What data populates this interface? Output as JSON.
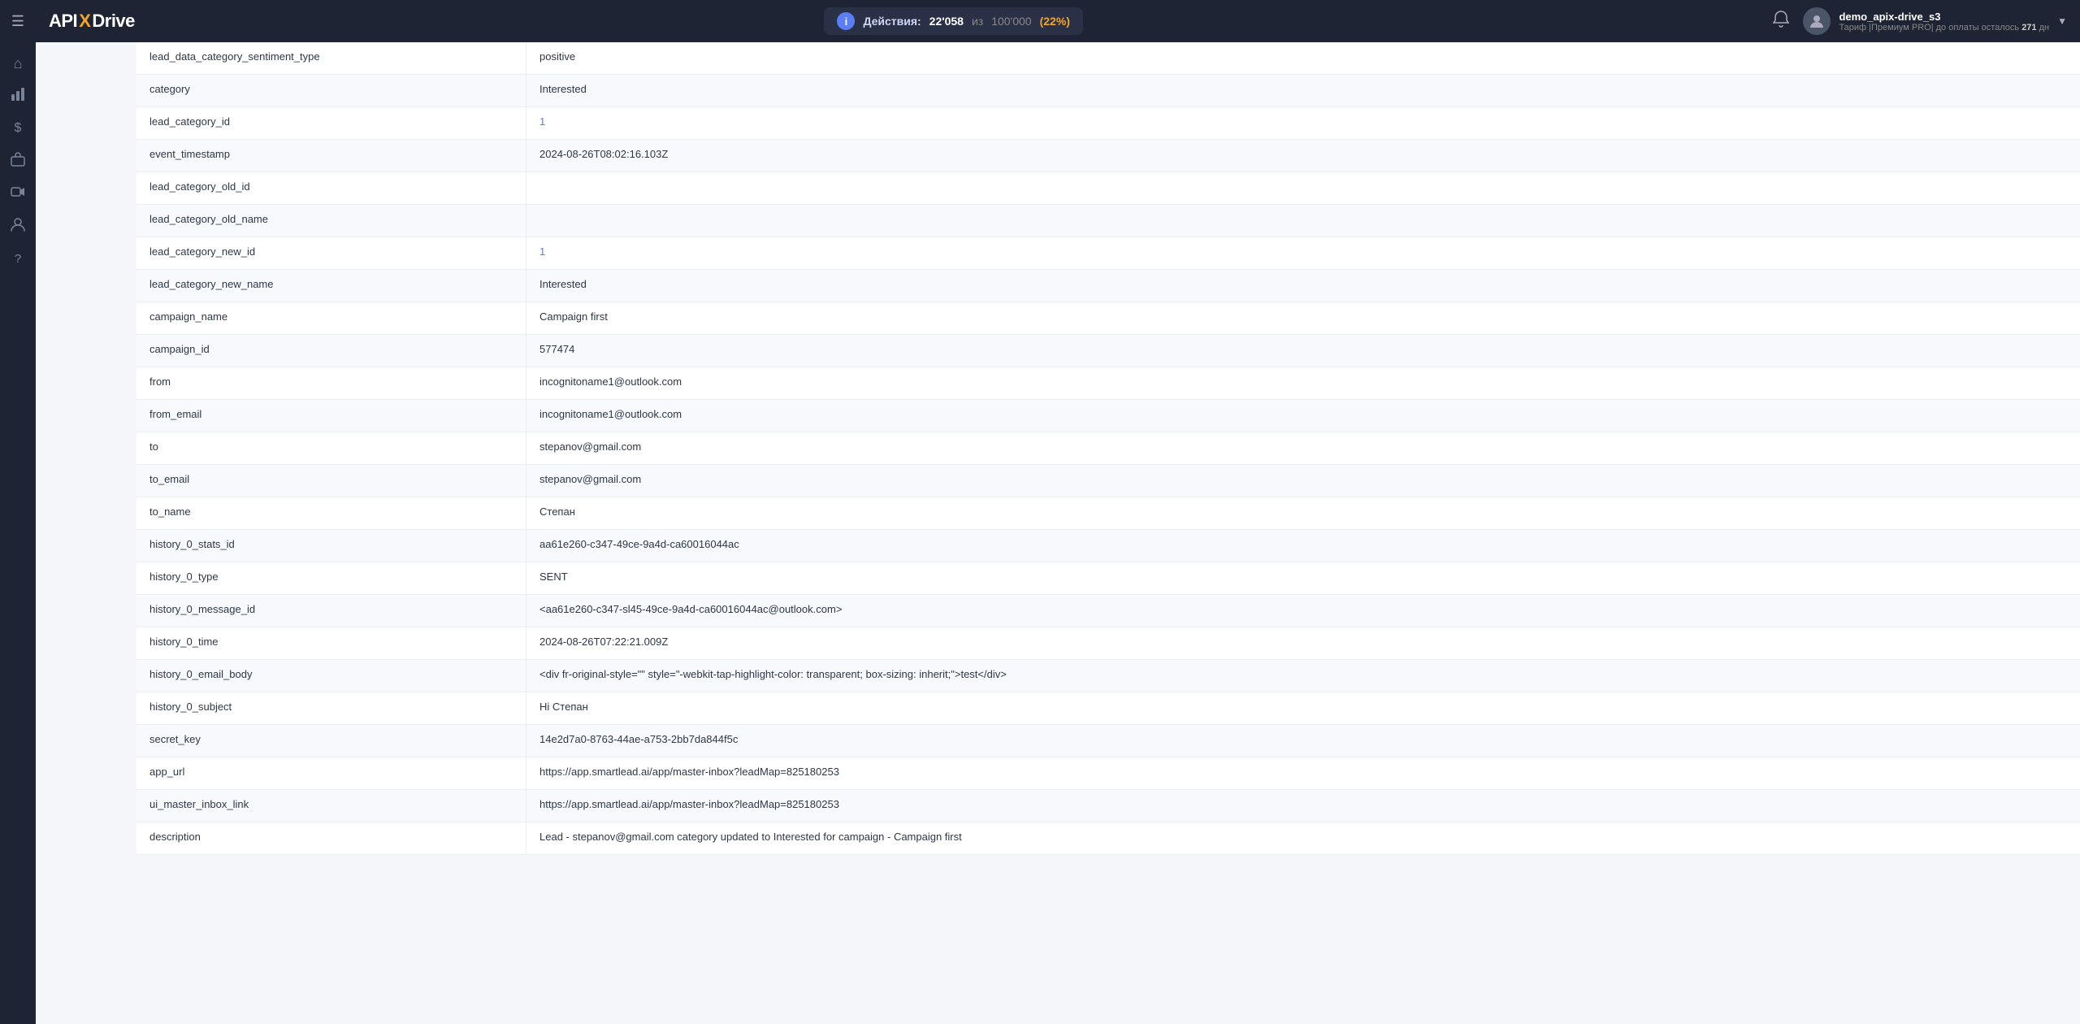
{
  "sidebar": {
    "hamburger": "☰",
    "items": [
      {
        "name": "home",
        "icon": "⌂"
      },
      {
        "name": "diagram",
        "icon": "⊞"
      },
      {
        "name": "dollar",
        "icon": "$"
      },
      {
        "name": "briefcase",
        "icon": "⊡"
      },
      {
        "name": "video",
        "icon": "▶"
      },
      {
        "name": "user",
        "icon": "👤"
      },
      {
        "name": "help",
        "icon": "?"
      }
    ]
  },
  "topbar": {
    "logo": {
      "api": "API",
      "x": "X",
      "drive": "Drive"
    },
    "actions_label": "Действия:",
    "actions_count": "22'058",
    "actions_separator": "из",
    "actions_limit": "100'000",
    "actions_pct": "(22%)",
    "user": {
      "name": "demo_apix-drive_s3",
      "plan_label": "Тариф |Премиум PRO| до оплаты осталось",
      "days": "271",
      "days_label": "дн"
    }
  },
  "table": {
    "rows": [
      {
        "field": "lead_data_category_sentiment_type",
        "value": "positive",
        "type": "normal"
      },
      {
        "field": "category",
        "value": "Interested",
        "type": "normal"
      },
      {
        "field": "lead_category_id",
        "value": "1",
        "type": "blue"
      },
      {
        "field": "event_timestamp",
        "value": "2024-08-26T08:02:16.103Z",
        "type": "normal"
      },
      {
        "field": "lead_category_old_id",
        "value": "",
        "type": "normal"
      },
      {
        "field": "lead_category_old_name",
        "value": "",
        "type": "normal"
      },
      {
        "field": "lead_category_new_id",
        "value": "1",
        "type": "blue"
      },
      {
        "field": "lead_category_new_name",
        "value": "Interested",
        "type": "normal"
      },
      {
        "field": "campaign_name",
        "value": "Campaign first",
        "type": "normal"
      },
      {
        "field": "campaign_id",
        "value": "577474",
        "type": "normal"
      },
      {
        "field": "from",
        "value": "incognitoname1@outlook.com",
        "type": "normal"
      },
      {
        "field": "from_email",
        "value": "incognitoname1@outlook.com",
        "type": "normal"
      },
      {
        "field": "to",
        "value": "stepanov@gmail.com",
        "type": "normal"
      },
      {
        "field": "to_email",
        "value": "stepanov@gmail.com",
        "type": "normal"
      },
      {
        "field": "to_name",
        "value": "Степан",
        "type": "normal"
      },
      {
        "field": "history_0_stats_id",
        "value": "aa61e260-c347-49ce-9a4d-ca60016044ac",
        "type": "normal"
      },
      {
        "field": "history_0_type",
        "value": "SENT",
        "type": "normal"
      },
      {
        "field": "history_0_message_id",
        "value": "<aa61e260-c347-sl45-49ce-9a4d-ca60016044ac@outlook.com>",
        "type": "normal"
      },
      {
        "field": "history_0_time",
        "value": "2024-08-26T07:22:21.009Z",
        "type": "normal"
      },
      {
        "field": "history_0_email_body",
        "value": "<div fr-original-style=\"\" style=\"-webkit-tap-highlight-color: transparent; box-sizing: inherit;\">test</div>",
        "type": "normal"
      },
      {
        "field": "history_0_subject",
        "value": "Hi Степан",
        "type": "normal"
      },
      {
        "field": "secret_key",
        "value": "14e2d7a0-8763-44ae-a753-2bb7da844f5c",
        "type": "normal"
      },
      {
        "field": "app_url",
        "value": "https://app.smartlead.ai/app/master-inbox?leadMap=825180253",
        "type": "normal"
      },
      {
        "field": "ui_master_inbox_link",
        "value": "https://app.smartlead.ai/app/master-inbox?leadMap=825180253",
        "type": "normal"
      },
      {
        "field": "description",
        "value": "Lead - stepanov@gmail.com category updated to Interested for campaign - Campaign first",
        "type": "normal"
      }
    ]
  }
}
